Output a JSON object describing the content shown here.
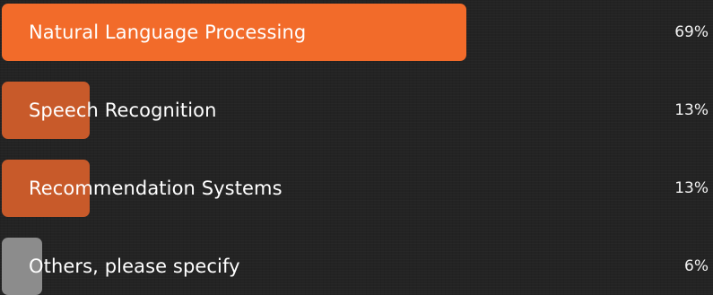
{
  "chart_data": {
    "type": "bar",
    "orientation": "horizontal",
    "categories": [
      "Natural Language Processing",
      "Speech Recognition",
      "Recommendation Systems",
      "Others, please specify"
    ],
    "values": [
      69,
      13,
      13,
      6
    ],
    "value_labels": [
      "69%",
      "13%",
      "13%",
      "6%"
    ],
    "unit": "%",
    "xlim": [
      0,
      100
    ],
    "grid": false,
    "legend": "none",
    "bar_colors": [
      "#f26b2a",
      "#c85a2a",
      "#c85a2a",
      "#8c8c8c"
    ],
    "title": "",
    "xlabel": "",
    "ylabel": ""
  },
  "colors": {
    "background": "#232323",
    "text": "#ffffff"
  }
}
